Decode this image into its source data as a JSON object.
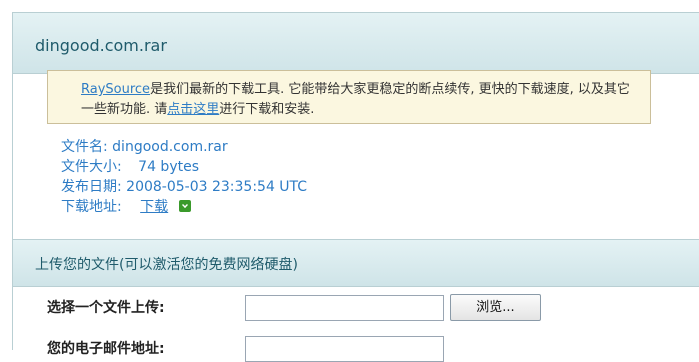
{
  "header": {
    "title": "dingood.com.rar"
  },
  "notice": {
    "link_raysource": "RaySource",
    "text_part1": "是我们最新的下载工具. 它能带给大家更稳定的断点续传, 更快的下载速度, 以及其它一些新功能. 请",
    "link_click_here": "点击这里",
    "text_part2": "进行下载和安装."
  },
  "file_info": {
    "name_label": "文件名:",
    "name_value": "dingood.com.rar",
    "size_label": "文件大小:",
    "size_value": "74 bytes",
    "date_label": "发布日期:",
    "date_value": "2008-05-03 23:35:54 UTC",
    "download_label": "下载地址:",
    "download_link": "下载"
  },
  "upload": {
    "section_title": "上传您的文件(可以激活您的免费网络硬盘)",
    "file_label": "选择一个文件上传:",
    "browse_label": "浏览...",
    "email_label": "您的电子邮件地址:"
  },
  "colors": {
    "link": "#2e7cc5",
    "header_bg": "#cfe4e8",
    "notice_bg": "#fbf7e0"
  },
  "icons": {
    "download": "download-arrow-icon"
  }
}
